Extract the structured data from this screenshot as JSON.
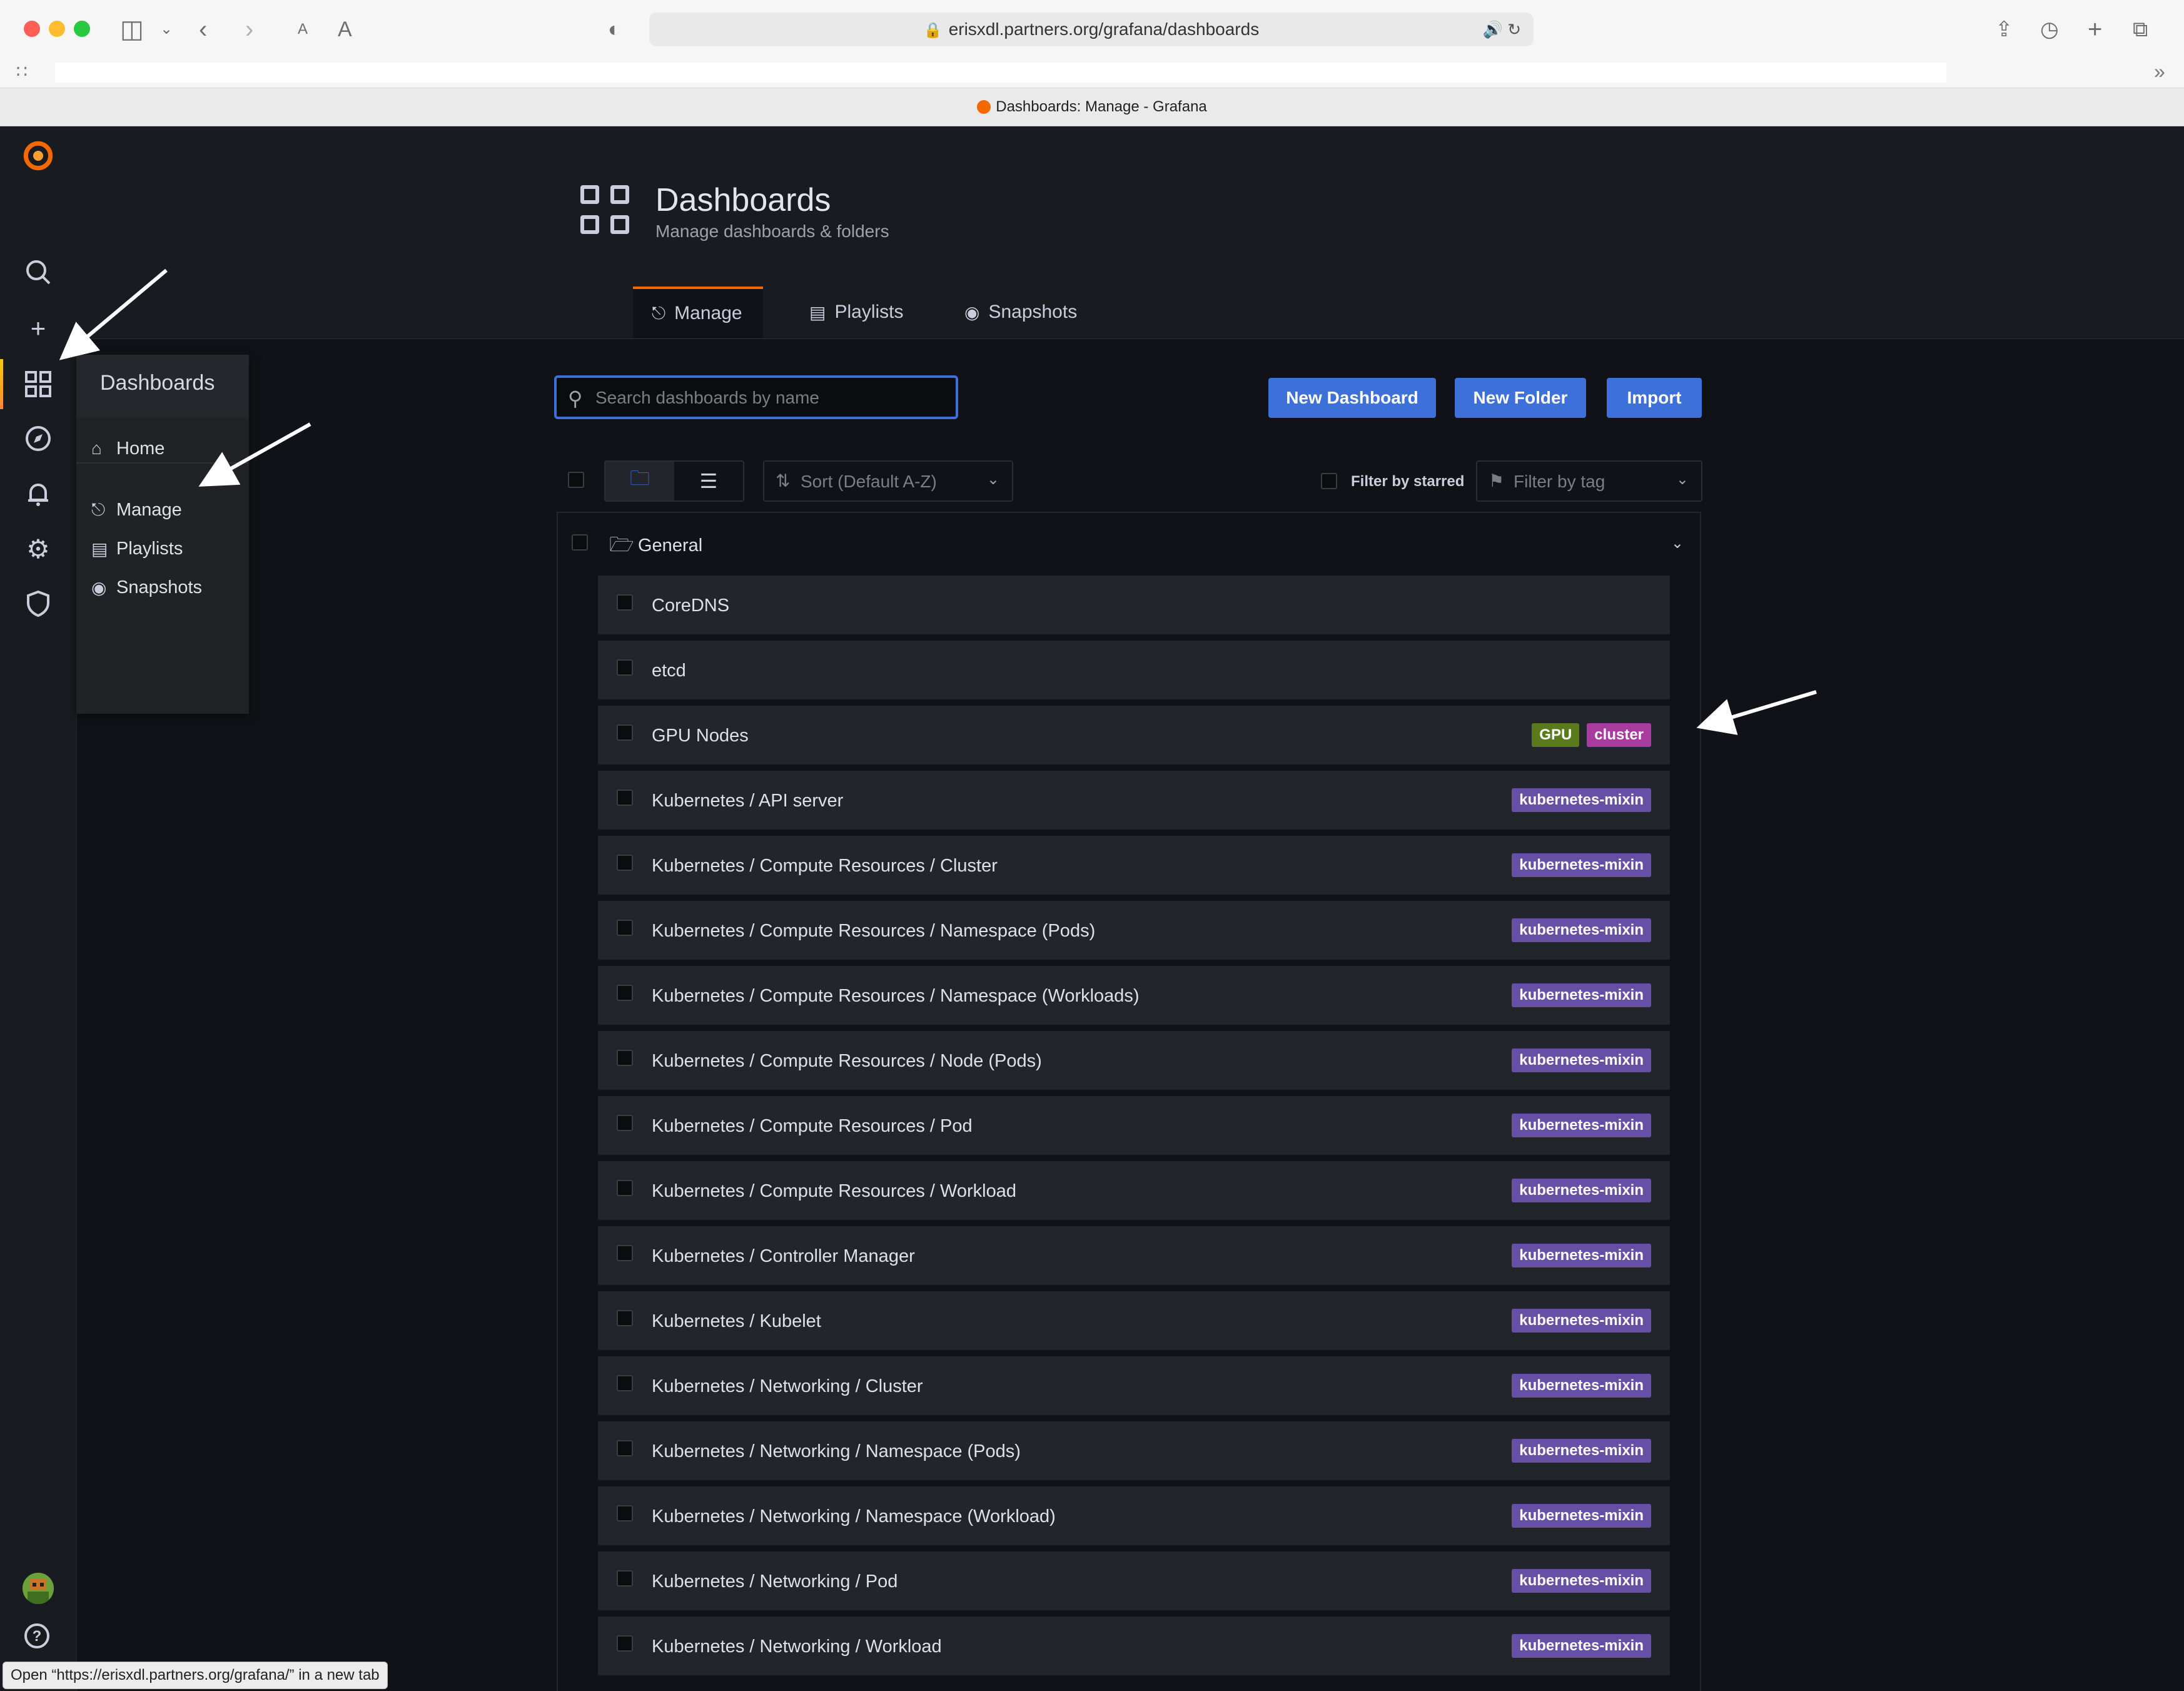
{
  "browser": {
    "url": "erisxdl.partners.org/grafana/dashboards",
    "tab_title": "Dashboards: Manage - Grafana",
    "status_text": "Open “https://erisxdl.partners.org/grafana/” in a new tab"
  },
  "sidemenu": {
    "icons": [
      "grafana-logo-icon",
      "search-icon",
      "plus-icon",
      "dashboards-icon",
      "explore-compass-icon",
      "alerting-bell-icon",
      "configuration-gear-icon",
      "server-admin-shield-icon",
      "user-avatar",
      "help-icon"
    ]
  },
  "flyout": {
    "title": "Dashboards",
    "items": [
      {
        "label": "Home",
        "icon": "home-icon"
      },
      {
        "label": "Manage",
        "icon": "sitemap-icon"
      },
      {
        "label": "Playlists",
        "icon": "presentation-icon"
      },
      {
        "label": "Snapshots",
        "icon": "camera-icon"
      }
    ]
  },
  "header": {
    "title": "Dashboards",
    "subtitle": "Manage dashboards & folders",
    "tabs": [
      {
        "label": "Manage",
        "active": true
      },
      {
        "label": "Playlists",
        "active": false
      },
      {
        "label": "Snapshots",
        "active": false
      }
    ]
  },
  "toolbar": {
    "search_placeholder": "Search dashboards by name",
    "new_dashboard_label": "New Dashboard",
    "new_folder_label": "New Folder",
    "import_label": "Import",
    "sort_label": "Sort (Default A-Z)",
    "starred_label": "Filter by starred",
    "tag_placeholder": "Filter by tag"
  },
  "folder": {
    "name": "General",
    "dashboards": [
      {
        "title": "CoreDNS",
        "tags": []
      },
      {
        "title": "etcd",
        "tags": []
      },
      {
        "title": "GPU Nodes",
        "tags": [
          {
            "label": "GPU",
            "color": "#5a7a1e"
          },
          {
            "label": "cluster",
            "color": "#a83b9e"
          }
        ]
      },
      {
        "title": "Kubernetes / API server",
        "tags": [
          {
            "label": "kubernetes-mixin",
            "color": "#6650a6"
          }
        ]
      },
      {
        "title": "Kubernetes / Compute Resources / Cluster",
        "tags": [
          {
            "label": "kubernetes-mixin",
            "color": "#6650a6"
          }
        ]
      },
      {
        "title": "Kubernetes / Compute Resources / Namespace (Pods)",
        "tags": [
          {
            "label": "kubernetes-mixin",
            "color": "#6650a6"
          }
        ]
      },
      {
        "title": "Kubernetes / Compute Resources / Namespace (Workloads)",
        "tags": [
          {
            "label": "kubernetes-mixin",
            "color": "#6650a6"
          }
        ]
      },
      {
        "title": "Kubernetes / Compute Resources / Node (Pods)",
        "tags": [
          {
            "label": "kubernetes-mixin",
            "color": "#6650a6"
          }
        ]
      },
      {
        "title": "Kubernetes / Compute Resources / Pod",
        "tags": [
          {
            "label": "kubernetes-mixin",
            "color": "#6650a6"
          }
        ]
      },
      {
        "title": "Kubernetes / Compute Resources / Workload",
        "tags": [
          {
            "label": "kubernetes-mixin",
            "color": "#6650a6"
          }
        ]
      },
      {
        "title": "Kubernetes / Controller Manager",
        "tags": [
          {
            "label": "kubernetes-mixin",
            "color": "#6650a6"
          }
        ]
      },
      {
        "title": "Kubernetes / Kubelet",
        "tags": [
          {
            "label": "kubernetes-mixin",
            "color": "#6650a6"
          }
        ]
      },
      {
        "title": "Kubernetes / Networking / Cluster",
        "tags": [
          {
            "label": "kubernetes-mixin",
            "color": "#6650a6"
          }
        ]
      },
      {
        "title": "Kubernetes / Networking / Namespace (Pods)",
        "tags": [
          {
            "label": "kubernetes-mixin",
            "color": "#6650a6"
          }
        ]
      },
      {
        "title": "Kubernetes / Networking / Namespace (Workload)",
        "tags": [
          {
            "label": "kubernetes-mixin",
            "color": "#6650a6"
          }
        ]
      },
      {
        "title": "Kubernetes / Networking / Pod",
        "tags": [
          {
            "label": "kubernetes-mixin",
            "color": "#6650a6"
          }
        ]
      },
      {
        "title": "Kubernetes / Networking / Workload",
        "tags": [
          {
            "label": "kubernetes-mixin",
            "color": "#6650a6"
          }
        ]
      }
    ]
  },
  "colors": {
    "accent": "#3d71d9",
    "brand": "#f46800",
    "background": "#111217",
    "row": "#22252b"
  }
}
